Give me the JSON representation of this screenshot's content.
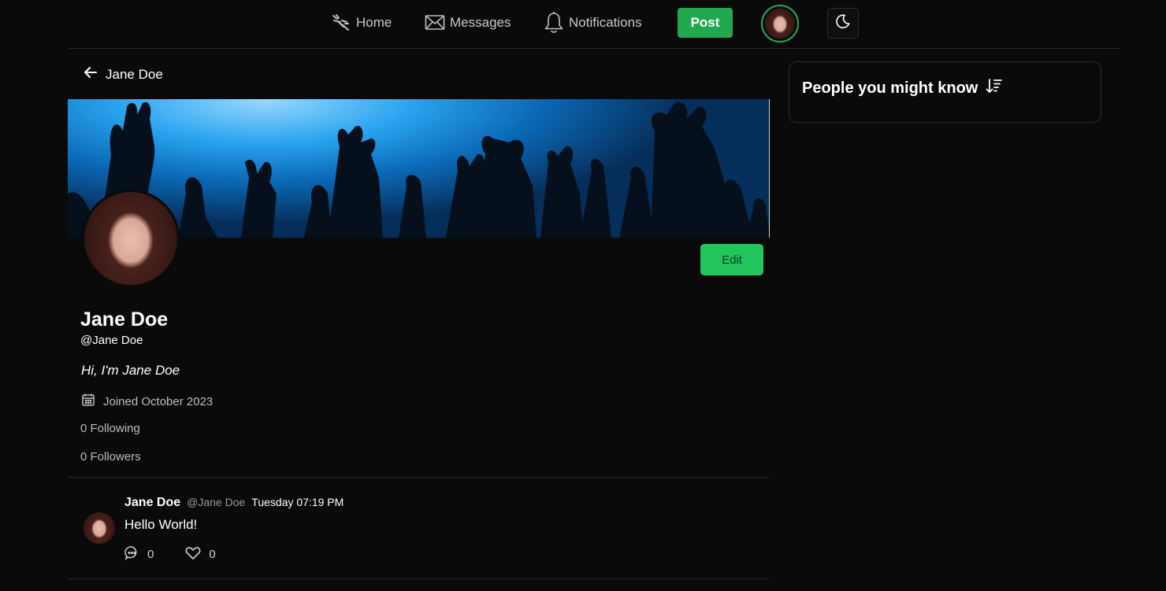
{
  "nav": {
    "home_label": "Home",
    "messages_label": "Messages",
    "notifications_label": "Notifications",
    "post_label": "Post"
  },
  "header": {
    "back_title": "Jane Doe"
  },
  "profile": {
    "display_name": "Jane Doe",
    "handle": "@Jane Doe",
    "bio": "Hi, I'm Jane Doe",
    "joined": "Joined October 2023",
    "following": "0 Following",
    "followers": "0 Followers",
    "edit_label": "Edit"
  },
  "posts": [
    {
      "author": "Jane Doe",
      "handle": "@Jane Doe",
      "time": "Tuesday 07:19 PM",
      "text": "Hello World!",
      "comments": "0",
      "likes": "0"
    }
  ],
  "sidebar": {
    "title": "People you might know"
  },
  "colors": {
    "background": "#0b0a0a",
    "accent": "#22c55e",
    "post_button": "#22a94f",
    "banner_blue": "#2aa4ef"
  },
  "icons": [
    "feather-icon",
    "envelope-icon",
    "bell-icon",
    "moon-icon",
    "arrow-left-icon",
    "calendar-icon",
    "comment-icon",
    "heart-icon",
    "sort-descending-icon"
  ]
}
